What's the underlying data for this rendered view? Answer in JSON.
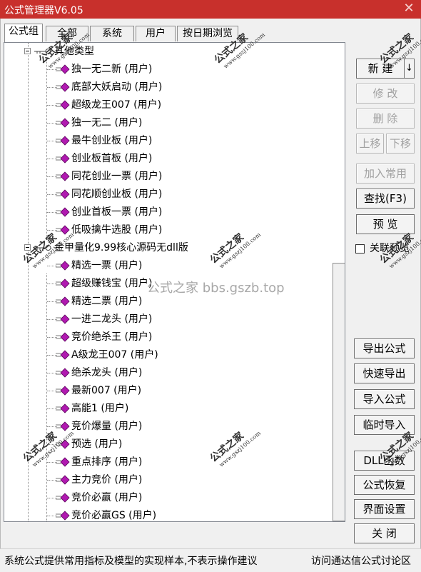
{
  "window": {
    "title": "公式管理器V6.05",
    "close_glyph": "✕"
  },
  "tabs": [
    {
      "label": "公式组"
    },
    {
      "label": "全部"
    },
    {
      "label": "系统"
    },
    {
      "label": "用户"
    },
    {
      "label": "按日期浏览"
    }
  ],
  "tree": {
    "groups": [
      {
        "label": "其他类型",
        "items": [
          "独一无二新 (用户)",
          "底部大妖启动 (用户)",
          "超级龙王007 (用户)",
          "独一无二 (用户)",
          "最牛创业板 (用户)",
          "创业板首板 (用户)",
          "同花创业一票 (用户)",
          "同花顺创业板 (用户)",
          "创业首板一票 (用户)",
          "低吸擒牛选股 (用户)"
        ]
      },
      {
        "label": "金甲量化9.99核心源码无dll版",
        "items": [
          "精选一票 (用户)",
          "超级赚钱宝 (用户)",
          "精选二票 (用户)",
          "一进二龙头 (用户)",
          "竞价绝杀王 (用户)",
          "A级龙王007 (用户)",
          "绝杀龙头 (用户)",
          "最新007 (用户)",
          "高能1 (用户)",
          "竞价爆量 (用户)",
          "预选 (用户)",
          "重点排序 (用户)",
          "主力竞价 (用户)",
          "竞价必赢 (用户)",
          "竞价必赢GS (用户)"
        ]
      }
    ]
  },
  "buttons": {
    "new": "新 建",
    "new_arrow": "↓",
    "edit": "修 改",
    "delete": "删 除",
    "move_up": "上移",
    "move_down": "下移",
    "add_common": "加入常用",
    "find": "查找(F3)",
    "preview": "预 览",
    "export": "导出公式",
    "quick_export": "快速导出",
    "import": "导入公式",
    "temp_import": "临时导入",
    "dll": "DLL函数",
    "restore": "公式恢复",
    "ui_settings": "界面设置",
    "close": "关 闭"
  },
  "checkbox": {
    "label": "关联预览",
    "checked": false
  },
  "status": {
    "left": "系统公式提供常用指标及模型的实现样本,不表示操作建议",
    "right": "访问通达信公式讨论区"
  },
  "watermark": {
    "center": "公式之家 bbs.gszb.top",
    "stamp": "公式之家",
    "stamp_url": "www.gszj100.com"
  },
  "colors": {
    "titlebar": "#c8302c",
    "diamond": "#b01ab0",
    "disabled_text": "#a0a0a0"
  }
}
